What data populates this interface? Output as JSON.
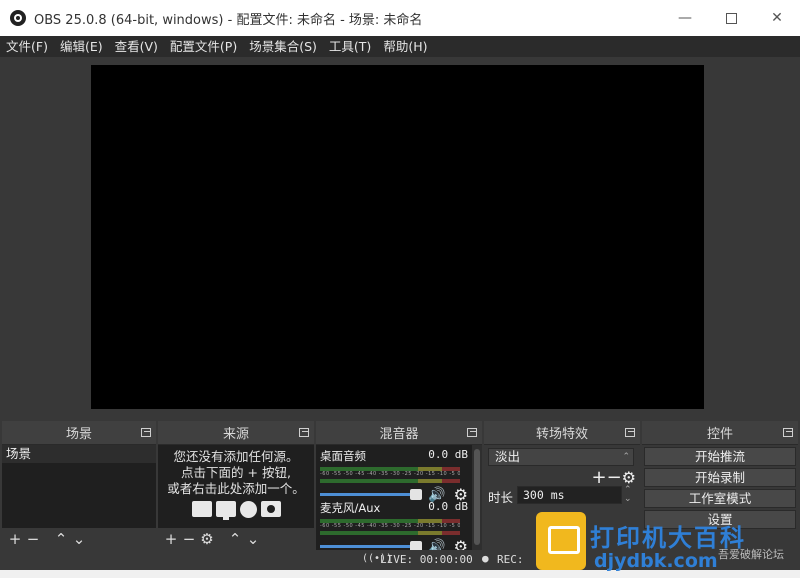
{
  "window": {
    "title": "OBS 25.0.8 (64-bit, windows) - 配置文件: 未命名 - 场景: 未命名",
    "min": "—",
    "close": "✕"
  },
  "menu": [
    "文件(F)",
    "编辑(E)",
    "查看(V)",
    "配置文件(P)",
    "场景集合(S)",
    "工具(T)",
    "帮助(H)"
  ],
  "docks": {
    "scenes": {
      "title": "场景",
      "items": [
        "场景"
      ]
    },
    "sources": {
      "title": "来源",
      "empty_line1": "您还没有添加任何源。",
      "empty_line2": "点击下面的 + 按钮,",
      "empty_line3": "或者右击此处添加一个。"
    },
    "mixer": {
      "title": "混音器",
      "ticks": "-60 -55 -50 -45 -40 -35 -30 -25 -20 -15 -10 -5 0",
      "channels": [
        {
          "name": "桌面音频",
          "db": "0.0 dB"
        },
        {
          "name": "麦克风/Aux",
          "db": "0.0 dB"
        }
      ]
    },
    "transitions": {
      "title": "转场特效",
      "selected": "淡出",
      "duration_label": "时长",
      "duration_value": "300 ms"
    },
    "controls": {
      "title": "控件",
      "buttons": [
        "开始推流",
        "开始录制",
        "工作室模式",
        "设置"
      ]
    }
  },
  "status": {
    "live": "LIVE: 00:00:00",
    "rec": "REC:"
  },
  "watermark": {
    "brand": "打印机大百科",
    "url": "djydbk.com",
    "forum": "吾爱破解论坛"
  },
  "colors": {
    "panel_bg": "#383838",
    "list_bg": "#1f1f1f",
    "fader": "#4d8fd6",
    "watermark_blue": "#2f7fd6",
    "watermark_yellow": "#f1b81e"
  }
}
